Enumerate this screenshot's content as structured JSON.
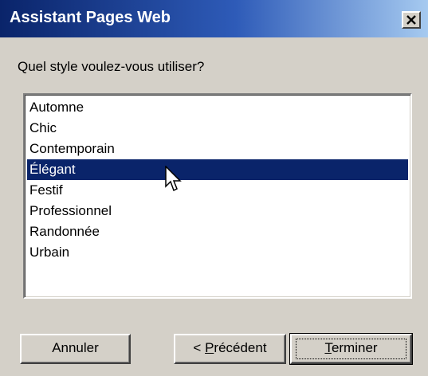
{
  "window": {
    "title": "Assistant Pages Web",
    "close_icon": "close-icon"
  },
  "prompt": "Quel style voulez-vous utiliser?",
  "styles": {
    "selected": "Élégant",
    "items": [
      {
        "label": "Automne"
      },
      {
        "label": "Chic"
      },
      {
        "label": "Contemporain"
      },
      {
        "label": "Élégant"
      },
      {
        "label": "Festif"
      },
      {
        "label": "Professionnel"
      },
      {
        "label": "Randonnée"
      },
      {
        "label": "Urbain"
      }
    ]
  },
  "buttons": {
    "cancel": "Annuler",
    "previous": {
      "prefix": "< ",
      "mnemonic": "P",
      "rest": "récédent"
    },
    "finish": {
      "mnemonic": "T",
      "rest": "erminer"
    }
  },
  "colors": {
    "selection": "#0a246a",
    "face": "#d4d0c8"
  }
}
